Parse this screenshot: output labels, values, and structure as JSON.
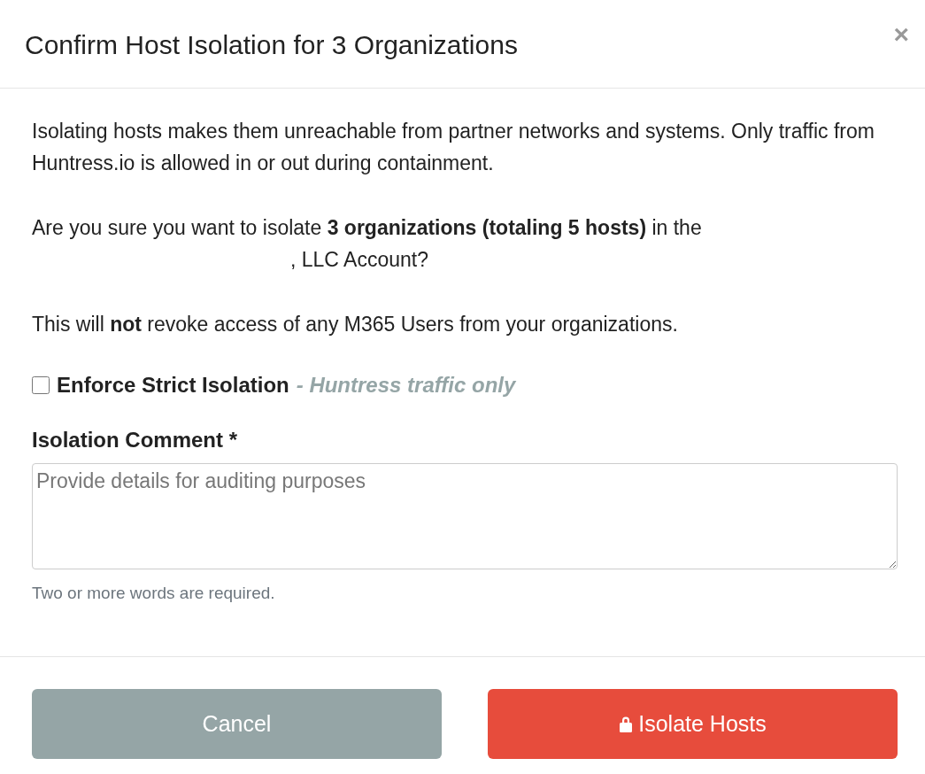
{
  "dialog": {
    "title": "Confirm Host Isolation for 3 Organizations",
    "close": "×"
  },
  "body": {
    "intro": "Isolating hosts makes them unreachable from partner networks and systems. Only traffic from Huntress.io is allowed in or out during containment.",
    "question": "Are you sure you want to isolate **3 organizations (totaling 5 hosts)** in the",
    "question_end": ", LLC Account?",
    "note": "This will **not** revoke access of any M365 Users from your organizations.",
    "strict": {
      "label": "Enforce Strict Isolation",
      "hint": "- Huntress traffic only",
      "checked": false
    },
    "comment": {
      "label": "Isolation Comment *",
      "placeholder": "Provide details for auditing purposes",
      "help": "Two or more words are required."
    }
  },
  "buttons": [
    {
      "kind": "cancel",
      "label": "Cancel"
    },
    {
      "kind": "danger",
      "label": "Isolate Hosts"
    }
  ]
}
